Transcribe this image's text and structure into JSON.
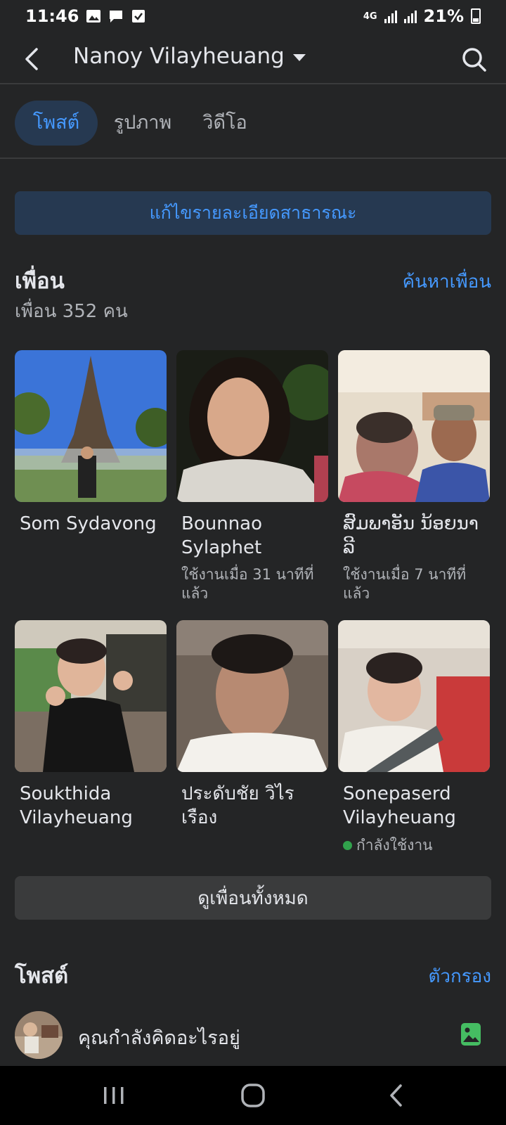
{
  "status_bar": {
    "time": "11:46",
    "network": "4G",
    "battery": "21%"
  },
  "header": {
    "title": "Nanoy Vilayheuang"
  },
  "tabs": [
    {
      "label": "โพสต์",
      "active": true
    },
    {
      "label": "รูปภาพ",
      "active": false
    },
    {
      "label": "วิดีโอ",
      "active": false
    }
  ],
  "edit_public_details": "แก้ไขรายละเอียดสาธารณะ",
  "friends": {
    "title": "เพื่อน",
    "count_text": "เพื่อน 352 คน",
    "find_link": "ค้นหาเพื่อน",
    "items": [
      {
        "name": "Som Sydavong",
        "sub": ""
      },
      {
        "name": "Bounnao Sylaphet",
        "sub": "ใช้งานเมื่อ 31 นาทีที่แล้ว"
      },
      {
        "name": "ສົມພາອັນ ນ້ອຍນາລີ",
        "sub": "ใช้งานเมื่อ 7 นาทีที่แล้ว"
      },
      {
        "name": "Soukthida Vilayheuang",
        "sub": ""
      },
      {
        "name": "ประดับชัย วิไรเรือง",
        "sub": ""
      },
      {
        "name": "Sonepaserd Vilayheuang",
        "sub": "",
        "online": "กำลังใช้งาน"
      }
    ],
    "see_all": "ดูเพื่อนทั้งหมด"
  },
  "posts": {
    "title": "โพสต์",
    "filter": "ตัวกรอง",
    "composer_placeholder": "คุณกำลังคิดอะไรอยู่"
  },
  "colors": {
    "background": "#242526",
    "accent": "#4599ff",
    "accent_bg": "#263951",
    "online": "#31a24c"
  }
}
